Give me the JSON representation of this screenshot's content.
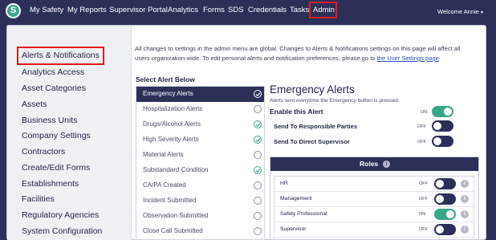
{
  "logo": {
    "letter": "S"
  },
  "nav": {
    "items": [
      "My Safety",
      "My Reports",
      "Supervisor Portal",
      "Analytics",
      "Forms",
      "SDS",
      "Credentials",
      "Tasks",
      "Admin"
    ],
    "welcome": "Welcome Annie",
    "welcome_caret": "▾"
  },
  "sidebar": {
    "items": [
      "Alerts & Notifications",
      "Analytics Access",
      "Asset Categories",
      "Assets",
      "Business Units",
      "Company Settings",
      "Contractors",
      "Create/Edit Forms",
      "Establishments",
      "Facilities",
      "Regulatory Agencies",
      "System Configuration"
    ],
    "active": "Alerts & Notifications"
  },
  "info": {
    "text": "All changes to settings in the admin menu are global. Changes to Alerts & Notifications settings on this page will affect all users organization-wide. To edit personal alerts and notification preferences, please go to ",
    "link": "the User Settings page"
  },
  "alerts": {
    "title": "Select Alert Below",
    "items": [
      {
        "label": "Emergency Alerts",
        "enabled": true,
        "active": true
      },
      {
        "label": "Hospitalization Alerts",
        "enabled": false
      },
      {
        "label": "Drugs/Alcohol Alerts",
        "enabled": true
      },
      {
        "label": "High Severity Alerts",
        "enabled": true
      },
      {
        "label": "Material Alerts",
        "enabled": false
      },
      {
        "label": "Substandard Condition",
        "enabled": true
      },
      {
        "label": "CA/PA Created",
        "enabled": false
      },
      {
        "label": "Incident Submitted",
        "enabled": false
      },
      {
        "label": "Observation Submitted",
        "enabled": false
      },
      {
        "label": "Close Call Submitted",
        "enabled": false
      }
    ]
  },
  "detail": {
    "title": "Emergency Alerts",
    "description": "Alerts sent everytime the Emergency button is pressed.",
    "enable_label": "Enable this Alert",
    "enable_state": "ON",
    "send_responsible_label": "Send To Responsible Parties",
    "send_responsible_state": "OFF",
    "send_supervisor_label": "Send To Direct Supervisor",
    "send_supervisor_state": "OFF"
  },
  "roles": {
    "title": "Roles",
    "info_glyph": "i",
    "items": [
      {
        "name": "HR",
        "state": "OFF"
      },
      {
        "name": "Management",
        "state": "OFF"
      },
      {
        "name": "Safety Professional",
        "state": "ON"
      },
      {
        "name": "Supervisor",
        "state": "OFF"
      }
    ]
  },
  "colors": {
    "navy": "#2c3059",
    "green": "#3aa68a",
    "highlight_red": "#e21b1b"
  }
}
